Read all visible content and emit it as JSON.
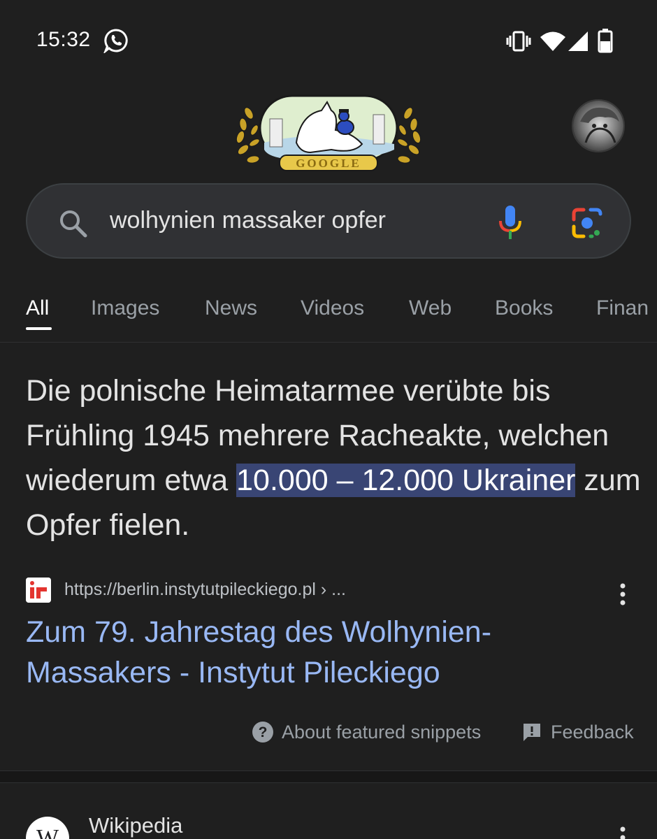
{
  "status_bar": {
    "time": "15:32",
    "icons": [
      "whatsapp-icon",
      "vibrate-icon",
      "wifi-icon",
      "signal-icon",
      "battery-icon"
    ]
  },
  "header": {
    "doodle_label": "GOOGLE",
    "avatar": "profile-avatar"
  },
  "search": {
    "query": "wolhynien massaker opfer",
    "icons": [
      "search-icon",
      "mic-icon",
      "lens-icon"
    ]
  },
  "tabs": [
    {
      "label": "All",
      "active": true
    },
    {
      "label": "Images",
      "active": false
    },
    {
      "label": "News",
      "active": false
    },
    {
      "label": "Videos",
      "active": false
    },
    {
      "label": "Web",
      "active": false
    },
    {
      "label": "Books",
      "active": false
    },
    {
      "label": "Finan",
      "active": false
    }
  ],
  "featured_snippet": {
    "text_before": "Die polnische Heimatarmee verübte bis Frühling 1945 mehrere Racheakte, welchen wiederum etwa ",
    "highlight": "10.000 – 12.000 Ukrainer",
    "text_after": " zum Opfer fielen.",
    "source_url": "https://berlin.instytutpileckiego.pl › ...",
    "title": "Zum 79. Jahrestag des Wolhynien-Massakers - Instytut Pileckiego",
    "about_label": "About featured snippets",
    "feedback_label": "Feedback"
  },
  "next_result": {
    "site_name": "Wikipedia",
    "icon_letter": "W"
  },
  "colors": {
    "background": "#1f1f1f",
    "highlight": "#394574",
    "link": "#99b8f4",
    "tab_inactive": "#9aa0a6"
  }
}
